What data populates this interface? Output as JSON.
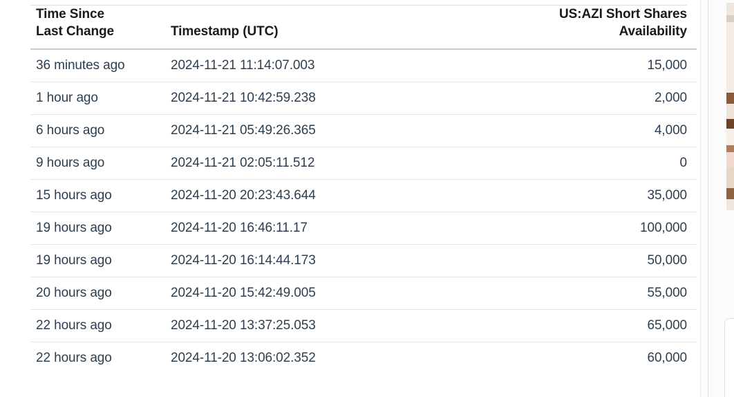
{
  "table": {
    "columns": [
      {
        "key": "time_since",
        "label_lines": [
          "Time Since",
          "Last Change"
        ],
        "align": "left"
      },
      {
        "key": "timestamp",
        "label": "Timestamp (UTC)",
        "align": "left"
      },
      {
        "key": "availability",
        "label": "US:AZI Short Shares Availability",
        "align": "right"
      }
    ],
    "header": {
      "time_since_line1": "Time Since",
      "time_since_line2": "Last Change",
      "timestamp": "Timestamp (UTC)",
      "availability": "US:AZI Short Shares Availability"
    },
    "clipped_row_top": {
      "time_since": "",
      "timestamp": "",
      "availability": ""
    },
    "rows": [
      {
        "time_since": "36 minutes ago",
        "timestamp": "2024-11-21 11:14:07.003",
        "availability": "15,000"
      },
      {
        "time_since": "1 hour ago",
        "timestamp": "2024-11-21 10:42:59.238",
        "availability": "2,000"
      },
      {
        "time_since": "6 hours ago",
        "timestamp": "2024-11-21 05:49:26.365",
        "availability": "4,000"
      },
      {
        "time_since": "9 hours ago",
        "timestamp": "2024-11-21 02:05:11.512",
        "availability": "0"
      },
      {
        "time_since": "15 hours ago",
        "timestamp": "2024-11-20 20:23:43.644",
        "availability": "35,000"
      },
      {
        "time_since": "19 hours ago",
        "timestamp": "2024-11-20 16:46:11.17",
        "availability": "100,000"
      },
      {
        "time_since": "19 hours ago",
        "timestamp": "2024-11-20 16:14:44.173",
        "availability": "50,000"
      },
      {
        "time_since": "20 hours ago",
        "timestamp": "2024-11-20 15:42:49.005",
        "availability": "55,000"
      },
      {
        "time_since": "22 hours ago",
        "timestamp": "2024-11-20 13:37:25.053",
        "availability": "65,000"
      },
      {
        "time_since": "22 hours ago",
        "timestamp": "2024-11-20 13:06:02.352",
        "availability": "60,000"
      }
    ]
  },
  "colors": {
    "page_background": "#ffffff",
    "header_text": "#1a1a1a",
    "body_text": "#2c3e50",
    "header_rule": "#c8ccd0",
    "row_rule": "#e3e3e3",
    "rail_background": "#fbfbfb",
    "rail_divider": "#e4e4e4"
  }
}
